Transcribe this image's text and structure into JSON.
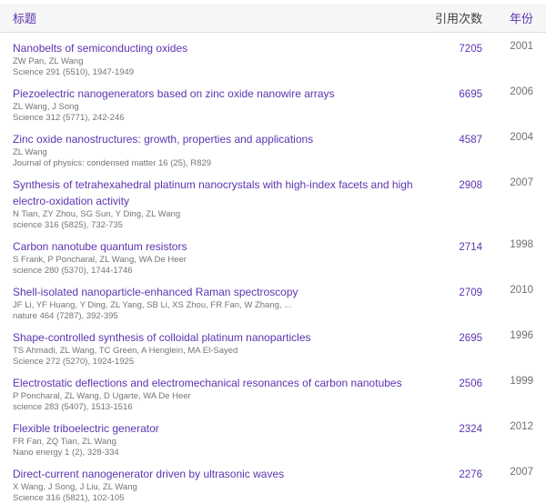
{
  "colors": {
    "link": "#5b34b1",
    "sorted_header": "#3f3f3f",
    "meta_text": "#757575",
    "year_text": "#6f6f6f",
    "header_bg": "#f6f6f6",
    "header_border": "#dddddd"
  },
  "header": {
    "title": "标题",
    "cited_by": "引用次数",
    "year": "年份"
  },
  "publications": [
    {
      "title": "Nanobelts of semiconducting oxides",
      "authors": "ZW Pan, ZL Wang",
      "venue": "Science 291 (5510), 1947-1949",
      "cited_by": "7205",
      "year": "2001"
    },
    {
      "title": "Piezoelectric nanogenerators based on zinc oxide nanowire arrays",
      "authors": "ZL Wang, J Song",
      "venue": "Science 312 (5771), 242-246",
      "cited_by": "6695",
      "year": "2006"
    },
    {
      "title": "Zinc oxide nanostructures: growth, properties and applications",
      "authors": "ZL Wang",
      "venue": "Journal of physics: condensed matter 16 (25), R829",
      "cited_by": "4587",
      "year": "2004"
    },
    {
      "title": "Synthesis of tetrahexahedral platinum nanocrystals with high-index facets and high electro-oxidation activity",
      "authors": "N Tian, ZY Zhou, SG Sun, Y Ding, ZL Wang",
      "venue": "science 316 (5825), 732-735",
      "cited_by": "2908",
      "year": "2007"
    },
    {
      "title": "Carbon nanotube quantum resistors",
      "authors": "S Frank, P Poncharal, ZL Wang, WA De Heer",
      "venue": "science 280 (5370), 1744-1746",
      "cited_by": "2714",
      "year": "1998"
    },
    {
      "title": "Shell-isolated nanoparticle-enhanced Raman spectroscopy",
      "authors": "JF Li, YF Huang, Y Ding, ZL Yang, SB Li, XS Zhou, FR Fan, W Zhang, ...",
      "venue": "nature 464 (7287), 392-395",
      "cited_by": "2709",
      "year": "2010"
    },
    {
      "title": "Shape-controlled synthesis of colloidal platinum nanoparticles",
      "authors": "TS Ahmadi, ZL Wang, TC Green, A Henglein, MA El-Sayed",
      "venue": "Science 272 (5270), 1924-1925",
      "cited_by": "2695",
      "year": "1996"
    },
    {
      "title": "Electrostatic deflections and electromechanical resonances of carbon nanotubes",
      "authors": "P Poncharal, ZL Wang, D Ugarte, WA De Heer",
      "venue": "science 283 (5407), 1513-1516",
      "cited_by": "2506",
      "year": "1999"
    },
    {
      "title": "Flexible triboelectric generator",
      "authors": "FR Fan, ZQ Tian, ZL Wang",
      "venue": "Nano energy 1 (2), 328-334",
      "cited_by": "2324",
      "year": "2012"
    },
    {
      "title": "Direct-current nanogenerator driven by ultrasonic waves",
      "authors": "X Wang, J Song, J Liu, ZL Wang",
      "venue": "Science 316 (5821), 102-105",
      "cited_by": "2276",
      "year": "2007"
    }
  ]
}
